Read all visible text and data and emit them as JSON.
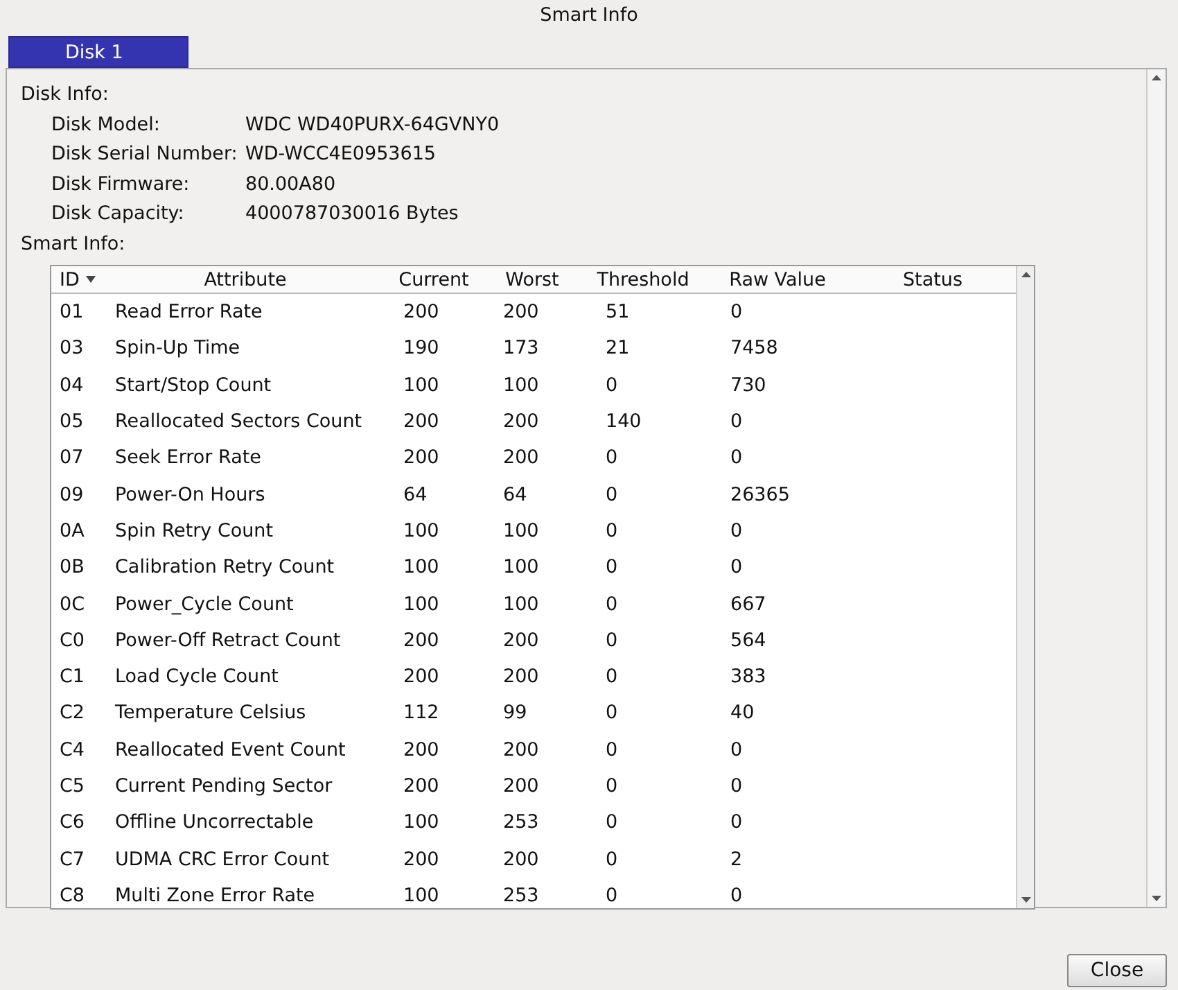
{
  "window": {
    "title": "Smart Info"
  },
  "tabs": [
    {
      "label": "Disk 1",
      "selected": true
    }
  ],
  "disk_info": {
    "heading": "Disk Info:",
    "fields": [
      {
        "label": "Disk Model:",
        "value": "WDC WD40PURX-64GVNY0"
      },
      {
        "label": "Disk Serial Number:",
        "value": "WD-WCC4E0953615"
      },
      {
        "label": "Disk Firmware:",
        "value": "80.00A80"
      },
      {
        "label": "Disk Capacity:",
        "value": "4000787030016 Bytes"
      }
    ]
  },
  "smart_info": {
    "heading": "Smart Info:",
    "columns": [
      "ID",
      "Attribute",
      "Current",
      "Worst",
      "Threshold",
      "Raw Value",
      "Status"
    ],
    "rows": [
      [
        "01",
        "Read Error Rate",
        "200",
        "200",
        "51",
        "0"
      ],
      [
        "03",
        "Spin-Up Time",
        "190",
        "173",
        "21",
        "7458"
      ],
      [
        "04",
        "Start/Stop Count",
        "100",
        "100",
        "0",
        "730"
      ],
      [
        "05",
        "Reallocated Sectors Count",
        "200",
        "200",
        "140",
        "0"
      ],
      [
        "07",
        "Seek Error Rate",
        "200",
        "200",
        "0",
        "0"
      ],
      [
        "09",
        "Power-On Hours",
        "64",
        "64",
        "0",
        "26365"
      ],
      [
        "0A",
        "Spin Retry Count",
        "100",
        "100",
        "0",
        "0"
      ],
      [
        "0B",
        "Calibration Retry Count",
        "100",
        "100",
        "0",
        "0"
      ],
      [
        "0C",
        "Power_Cycle Count",
        "100",
        "100",
        "0",
        "667"
      ],
      [
        "C0",
        "Power-Off Retract Count",
        "200",
        "200",
        "0",
        "564"
      ],
      [
        "C1",
        "Load Cycle Count",
        "200",
        "200",
        "0",
        "383"
      ],
      [
        "C2",
        "Temperature Celsius",
        "112",
        "99",
        "0",
        "40"
      ],
      [
        "C4",
        "Reallocated Event Count",
        "200",
        "200",
        "0",
        "0"
      ],
      [
        "C5",
        "Current Pending Sector",
        "200",
        "200",
        "0",
        "0"
      ],
      [
        "C6",
        "Offline Uncorrectable",
        "100",
        "253",
        "0",
        "0"
      ],
      [
        "C7",
        "UDMA CRC Error Count",
        "200",
        "200",
        "0",
        "2"
      ],
      [
        "C8",
        "Multi Zone Error Rate",
        "100",
        "253",
        "0",
        "0"
      ]
    ]
  },
  "buttons": [
    {
      "label": "Close"
    }
  ]
}
